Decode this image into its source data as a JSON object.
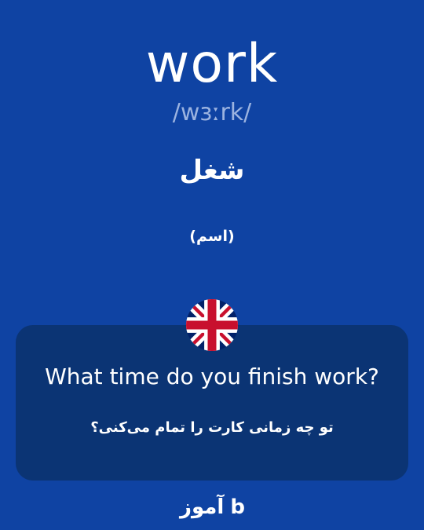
{
  "word": "work",
  "phonetic": "/wɜːrk/",
  "translation": "شغل",
  "part_of_speech": "(اسم)",
  "example": {
    "english": "What time do you finish work?",
    "persian": "تو چه زمانی کارت را تمام می‌کنی؟"
  },
  "flag_icon": "uk-flag-icon",
  "logo": "b آموز",
  "colors": {
    "background": "#0f43a3",
    "card": "#0b3474",
    "phonetic": "#9bb3e0",
    "text": "#ffffff"
  }
}
